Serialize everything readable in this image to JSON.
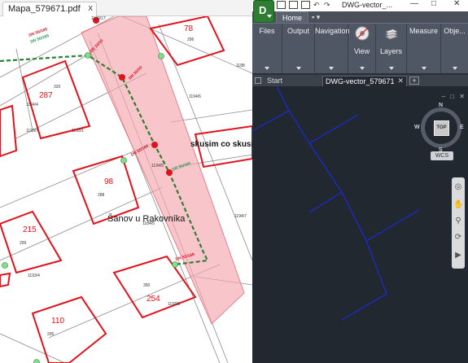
{
  "pdf_viewer": {
    "tab_title": "Mapa_579671.pdf",
    "tab_close": "x",
    "map": {
      "parcel_numbers": [
        "78",
        "287",
        "98",
        "215",
        "254",
        "110"
      ],
      "lot_numbers": [
        "1189/17",
        "296",
        "320",
        "1193/1",
        "1194/5",
        "1194/6",
        "288",
        "1184/5",
        "299",
        "1193/4",
        "1194/7",
        "350",
        "1193/3",
        "295",
        "1194/4",
        "1193/7",
        "1188"
      ],
      "pipe_labels": [
        "DN 50/165",
        "DN 24/50",
        "DN 50/50",
        "DN 50/160",
        "DN 50/165",
        "DN 50/160",
        "DN 53/168"
      ],
      "place_label": "Šanov u Rakovníka",
      "name_label": "skusim co skusi"
    }
  },
  "autocad": {
    "app_letter": "D",
    "window_title": "DWG-vector_...",
    "window_controls": [
      "—",
      "□",
      "✕"
    ],
    "ribbon_tabs": {
      "home": "Home",
      "extra": "▪ ▾"
    },
    "ribbon_groups": [
      "Files",
      "Output",
      "Navigation",
      "View",
      "Layers",
      "Measure",
      "Obje..."
    ],
    "doc_tabs": {
      "start": "Start",
      "active": "DWG-vector_579671",
      "close": "✕",
      "add": "+"
    },
    "viewport_controls": "– □ ✕",
    "viewcube": {
      "face": "TOP",
      "north": "N",
      "south": "S",
      "east": "E",
      "west": "W"
    },
    "ucs_label": "WCS",
    "line_color": "#1a2bd8",
    "background_color": "#212830"
  }
}
